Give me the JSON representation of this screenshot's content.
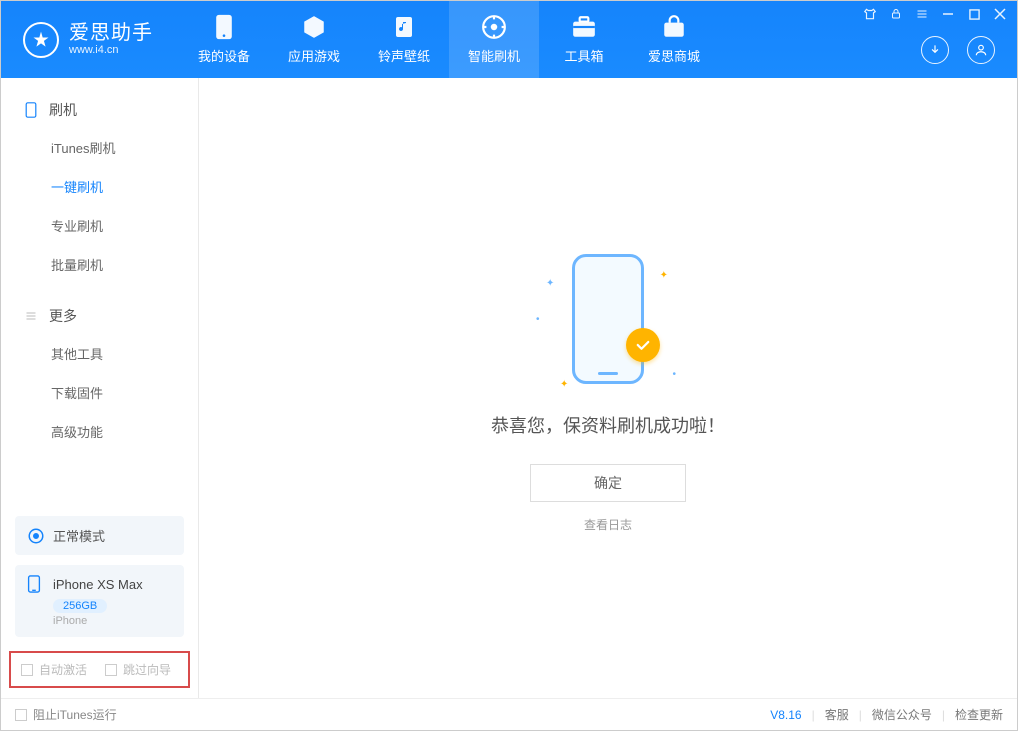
{
  "app": {
    "title": "爱思助手",
    "url": "www.i4.cn"
  },
  "nav": {
    "items": [
      {
        "label": "我的设备",
        "icon": "device-icon"
      },
      {
        "label": "应用游戏",
        "icon": "apps-icon"
      },
      {
        "label": "铃声壁纸",
        "icon": "ringtone-icon"
      },
      {
        "label": "智能刷机",
        "icon": "flash-icon",
        "active": true
      },
      {
        "label": "工具箱",
        "icon": "toolbox-icon"
      },
      {
        "label": "爱思商城",
        "icon": "store-icon"
      }
    ]
  },
  "sidebar": {
    "group1_title": "刷机",
    "group1_items": [
      {
        "label": "iTunes刷机"
      },
      {
        "label": "一键刷机",
        "active": true
      },
      {
        "label": "专业刷机"
      },
      {
        "label": "批量刷机"
      }
    ],
    "group2_title": "更多",
    "group2_items": [
      {
        "label": "其他工具"
      },
      {
        "label": "下载固件"
      },
      {
        "label": "高级功能"
      }
    ],
    "mode_label": "正常模式",
    "device": {
      "name": "iPhone XS Max",
      "capacity": "256GB",
      "type": "iPhone"
    },
    "check1": "自动激活",
    "check2": "跳过向导"
  },
  "main": {
    "message": "恭喜您，保资料刷机成功啦！",
    "ok_btn": "确定",
    "view_log": "查看日志"
  },
  "footer": {
    "block_itunes": "阻止iTunes运行",
    "version": "V8.16",
    "support": "客服",
    "wechat": "微信公众号",
    "check_update": "检查更新"
  }
}
